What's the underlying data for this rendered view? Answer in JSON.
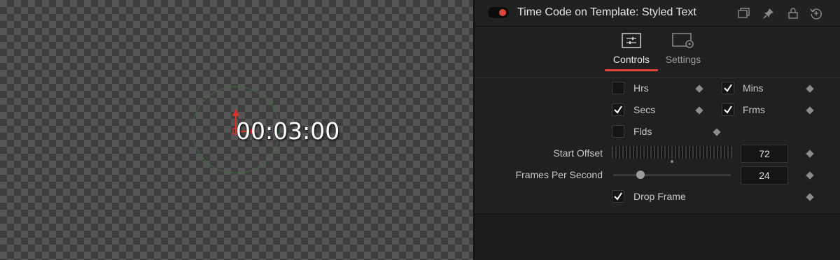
{
  "viewer": {
    "timecode_text": "00:03:00"
  },
  "inspector": {
    "title": "Time Code on Template: Styled Text",
    "node_enabled": true,
    "header_icons": [
      "window-icon",
      "pin-icon",
      "lock-icon",
      "reset-icon"
    ],
    "tabs": [
      {
        "label": "Controls",
        "active": true,
        "icon": "sliders-icon"
      },
      {
        "label": "Settings",
        "active": false,
        "icon": "settings-gear-icon"
      }
    ],
    "checkboxes": {
      "hrs": {
        "label": "Hrs",
        "checked": false
      },
      "mins": {
        "label": "Mins",
        "checked": true
      },
      "secs": {
        "label": "Secs",
        "checked": true
      },
      "frms": {
        "label": "Frms",
        "checked": true
      },
      "flds": {
        "label": "Flds",
        "checked": false
      },
      "drop_frame": {
        "label": "Drop Frame",
        "checked": true
      }
    },
    "start_offset": {
      "label": "Start Offset",
      "value": "72"
    },
    "fps": {
      "label": "Frames Per Second",
      "value": "24"
    }
  },
  "colors": {
    "accent": "#e0453b",
    "text_primary": "#e6e6e6",
    "text_secondary": "#c8c8c8",
    "panel_bg": "#202020"
  }
}
